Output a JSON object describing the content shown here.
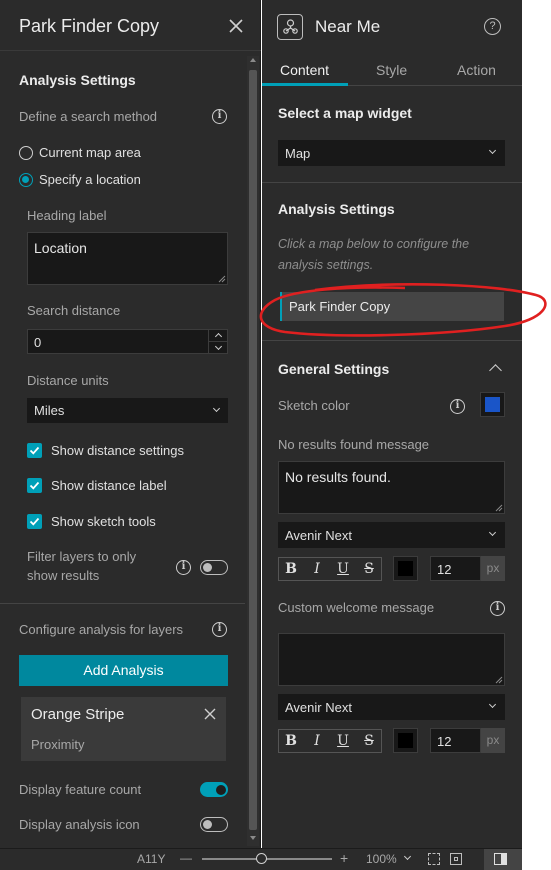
{
  "left_panel": {
    "title": "Park Finder Copy",
    "analysis_settings_heading": "Analysis Settings",
    "search_method_label": "Define a search method",
    "radio_current": "Current map area",
    "radio_specify": "Specify a location",
    "heading_label": "Heading label",
    "heading_value": "Location",
    "search_distance_label": "Search distance",
    "search_distance_value": "0",
    "distance_units_label": "Distance units",
    "distance_units_value": "Miles",
    "chk_show_distance_settings": "Show distance settings",
    "chk_show_distance_label": "Show distance label",
    "chk_show_sketch_tools": "Show sketch tools",
    "filter_layers_line1": "Filter layers to only",
    "filter_layers_line2": "show results",
    "configure_label": "Configure analysis for layers",
    "add_analysis_button": "Add Analysis",
    "analysis_card_title": "Orange Stripe",
    "analysis_card_sub": "Proximity",
    "display_feature_count": "Display feature count",
    "display_analysis_icon": "Display analysis icon"
  },
  "right_panel": {
    "title": "Near Me",
    "tabs": [
      "Content",
      "Style",
      "Action"
    ],
    "select_map_widget_heading": "Select a map widget",
    "map_select_value": "Map",
    "analysis_settings_heading": "Analysis Settings",
    "hint_line1": "Click a map below to configure the",
    "hint_line2": "analysis settings.",
    "map_item": "Park Finder Copy",
    "general_settings_heading": "General Settings",
    "sketch_color_label": "Sketch color",
    "no_results_label": "No results found message",
    "no_results_value": "No results found.",
    "font_value_1": "Avenir Next",
    "font_size_1": "12",
    "px_unit_1": "px",
    "custom_welcome_label": "Custom welcome message",
    "font_value_2": "Avenir Next",
    "font_size_2": "12",
    "px_unit_2": "px",
    "format_buttons": [
      "B",
      "I",
      "U",
      "S"
    ]
  },
  "status_bar": {
    "a11y": "A11Y",
    "zoom_minus": "—",
    "zoom_plus": "+",
    "zoom_level": "100%",
    "zoom_slider_fraction": 0.45
  },
  "colors": {
    "accent": "#00a0b8",
    "sketch_color": "#1a55c8",
    "annotation_red": "#e02020",
    "panel_bg": "#2b2b2b"
  },
  "icons": [
    "close-icon",
    "info-icon",
    "chevron-down-icon",
    "chevron-up-icon",
    "near-me-widget-icon",
    "help-icon",
    "check-icon",
    "fit-icon",
    "layout-icon"
  ]
}
